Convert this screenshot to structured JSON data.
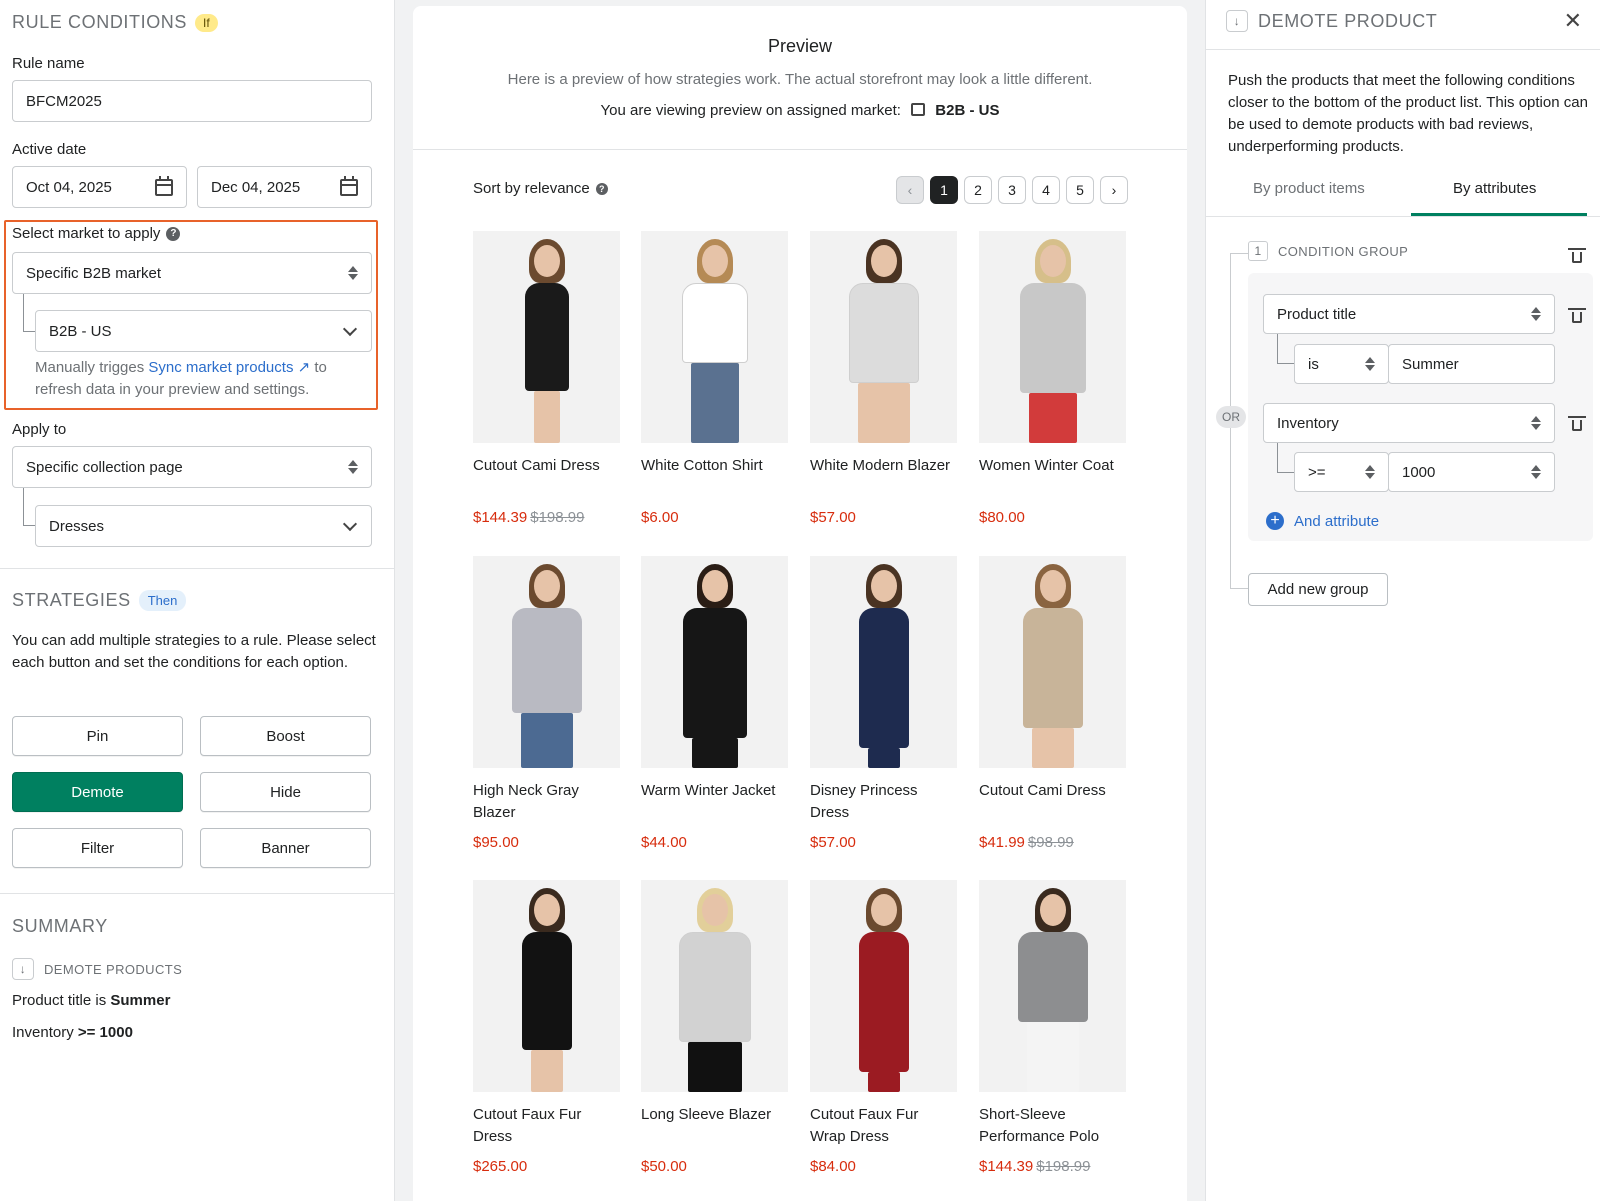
{
  "left": {
    "rule_conditions": {
      "title": "RULE CONDITIONS",
      "tag": "If"
    },
    "rule_name": {
      "label": "Rule name",
      "value": "BFCM2025"
    },
    "active_date": {
      "label": "Active date",
      "start": "Oct 04, 2025",
      "end": "Dec 04, 2025"
    },
    "market": {
      "label": "Select market to apply",
      "select_value": "Specific B2B market",
      "sub_value": "B2B - US",
      "hint_prefix": "Manually trigges",
      "hint_link": "Sync market products",
      "hint_suffix": "to refresh data in your preview and settings."
    },
    "apply_to": {
      "label": "Apply to",
      "select_value": "Specific collection page",
      "sub_value": "Dresses"
    },
    "strategies": {
      "title": "STRATEGIES",
      "tag": "Then",
      "desc": "You can add multiple strategies to a rule. Please select each button and set the conditions for each option.",
      "buttons": {
        "pin": "Pin",
        "boost": "Boost",
        "demote": "Demote",
        "hide": "Hide",
        "filter": "Filter",
        "banner": "Banner"
      }
    },
    "summary": {
      "title": "SUMMARY",
      "action": "DEMOTE PRODUCTS",
      "line1_label": "Product title is",
      "line1_value": "Summer",
      "line2_label": "Inventory",
      "line2_value": ">= 1000"
    }
  },
  "preview": {
    "title": "Preview",
    "subtitle": "Here is a preview of how strategies work. The actual storefront may look a little different.",
    "market_prefix": "You are viewing preview on assigned market:",
    "market_value": "B2B - US",
    "sort_label": "Sort by relevance",
    "pages": [
      "1",
      "2",
      "3",
      "4",
      "5"
    ],
    "products": [
      {
        "name": "Cutout Cami Dress",
        "price": "$144.39",
        "old": "$198.99"
      },
      {
        "name": "White Cotton Shirt",
        "price": "$6.00",
        "old": ""
      },
      {
        "name": "White Modern Blazer",
        "price": "$57.00",
        "old": ""
      },
      {
        "name": "Women Winter Coat",
        "price": "$80.00",
        "old": ""
      },
      {
        "name": "High Neck Gray Blazer",
        "price": "$95.00",
        "old": ""
      },
      {
        "name": "Warm Winter Jacket",
        "price": "$44.00",
        "old": ""
      },
      {
        "name": "Disney Princess Dress",
        "price": "$57.00",
        "old": ""
      },
      {
        "name": "Cutout Cami Dress",
        "price": "$41.99",
        "old": "$98.99"
      },
      {
        "name": "Cutout Faux Fur Dress",
        "price": "$265.00",
        "old": ""
      },
      {
        "name": "Long Sleeve Blazer",
        "price": "$50.00",
        "old": ""
      },
      {
        "name": "Cutout Faux Fur Wrap Dress",
        "price": "$84.00",
        "old": ""
      },
      {
        "name": "Short-Sleeve Performance Polo",
        "price": "$144.39",
        "old": "$198.99"
      }
    ]
  },
  "right": {
    "title": "DEMOTE PRODUCT",
    "description": "Push the products that meet the following conditions closer to the bottom of the product list. This option can be used to demote products with bad reviews, underperforming products.",
    "tabs": {
      "items": "By product items",
      "attributes": "By attributes"
    },
    "group_number": "1",
    "group_title": "CONDITION GROUP",
    "or_label": "OR",
    "cond1": {
      "field": "Product title",
      "operator": "is",
      "value": "Summer"
    },
    "cond2": {
      "field": "Inventory",
      "operator": ">=",
      "value": "1000"
    },
    "and_attribute": "And attribute",
    "add_group": "Add new group"
  },
  "colors": {
    "primary": "#008060",
    "highlight": "#e8622a",
    "price": "#d72c0d",
    "link": "#2c6ecb"
  }
}
